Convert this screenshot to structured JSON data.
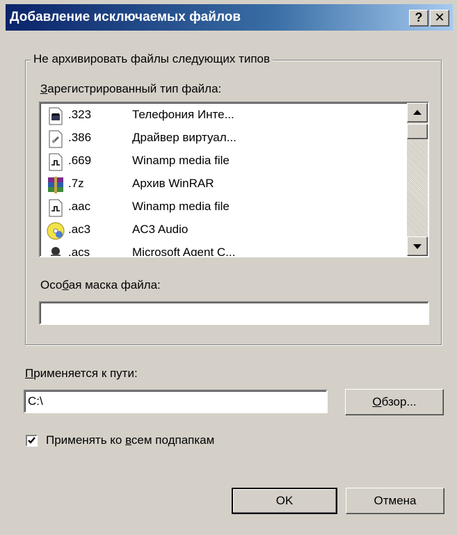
{
  "window": {
    "title": "Добавление исключаемых файлов",
    "help_button": "?",
    "close_button": "✕"
  },
  "group": {
    "legend": "Не архивировать файлы следующих типов",
    "registered_label": {
      "pre": "",
      "key": "З",
      "post": "арегистрированный тип файла:"
    },
    "file_types": [
      {
        "ext": ".323",
        "desc": "Телефония Инте...",
        "icon": "phone-file-icon"
      },
      {
        "ext": ".386",
        "desc": "Драйвер виртуал...",
        "icon": "driver-file-icon"
      },
      {
        "ext": ".669",
        "desc": "Winamp media file",
        "icon": "winamp-file-icon"
      },
      {
        "ext": ".7z",
        "desc": "Архив WinRAR",
        "icon": "winrar-archive-icon"
      },
      {
        "ext": ".aac",
        "desc": "Winamp media file",
        "icon": "winamp-file-icon"
      },
      {
        "ext": ".ac3",
        "desc": "AC3 Audio",
        "icon": "audio-cd-icon"
      },
      {
        "ext": ".acs",
        "desc": "Microsoft Agent C...",
        "icon": "agent-file-icon"
      }
    ],
    "mask_label": {
      "pre": "Осо",
      "key": "б",
      "post": "ая маска файла:"
    },
    "mask_value": ""
  },
  "path": {
    "label": {
      "pre": "",
      "key": "П",
      "post": "рименяется к пути:"
    },
    "value": "C:\\",
    "browse_button": {
      "pre": "",
      "key": "О",
      "post": "бзор..."
    }
  },
  "subfolders": {
    "checked": true,
    "label": {
      "pre": "Применять ко ",
      "key": "в",
      "post": "сем подпапкам"
    }
  },
  "buttons": {
    "ok": "OK",
    "cancel": "Отмена"
  },
  "colors": {
    "title_start": "#0a246a",
    "title_end": "#a6caf0",
    "face": "#d4d0c8"
  }
}
